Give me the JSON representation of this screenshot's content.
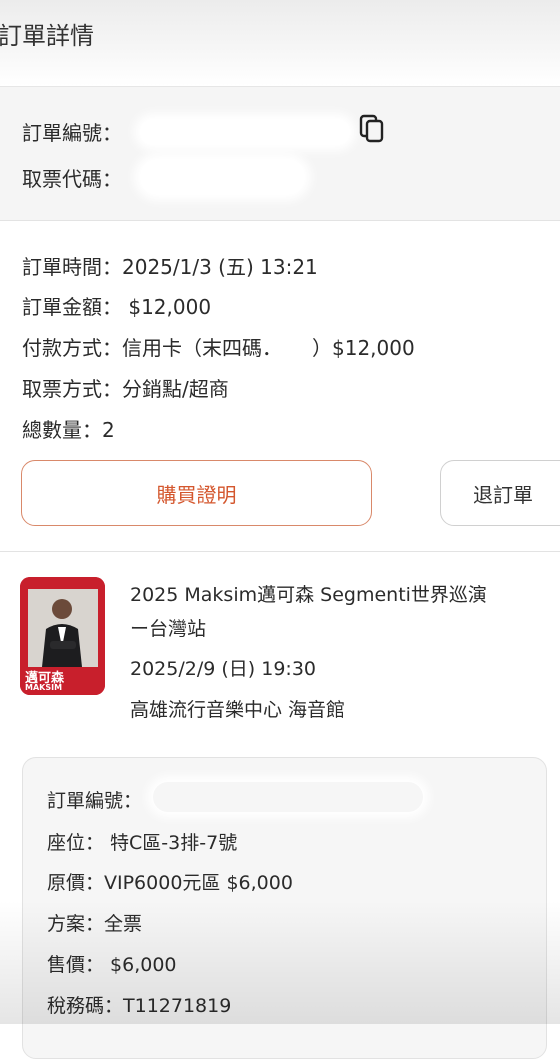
{
  "header": {
    "title": "訂單詳情"
  },
  "order_ids": {
    "order_no_label": "訂單編號：",
    "pickup_code_label": "取票代碼："
  },
  "order_info": {
    "time": "訂單時間：2025/1/3 (五) 13:21",
    "amount": "訂單金額： $12,000",
    "payment": "付款方式：信用卡（末四碼．　　）$12,000",
    "pickup_method": "取票方式：分銷點/超商",
    "total_qty": "總數量：2"
  },
  "actions": {
    "proof_label": "購買證明",
    "refund_label": "退訂單"
  },
  "event": {
    "title_line1": "2025 Maksim邁可森 Segmenti世界巡演",
    "title_line2": "ー台灣站",
    "datetime": "2025/2/9 (日) 19:30",
    "venue": "高雄流行音樂中心 海音館",
    "poster_text": "邁可森",
    "poster_sub": "MAKSIM"
  },
  "ticket": {
    "order_no_label": "訂單編號：",
    "seat": "座位： 特C區-3排-7號",
    "original_price": "原價：VIP6000元區 $6,000",
    "plan": "方案：全票",
    "sale_price": "售價： $6,000",
    "tax_code": "稅務碼：T11271819"
  },
  "colors": {
    "accent": "#d4572e",
    "accent_border": "#d9896a",
    "section_bg": "#f5f5f5",
    "poster_red": "#c81f2c"
  },
  "icons": {
    "copy": "copy-icon"
  }
}
